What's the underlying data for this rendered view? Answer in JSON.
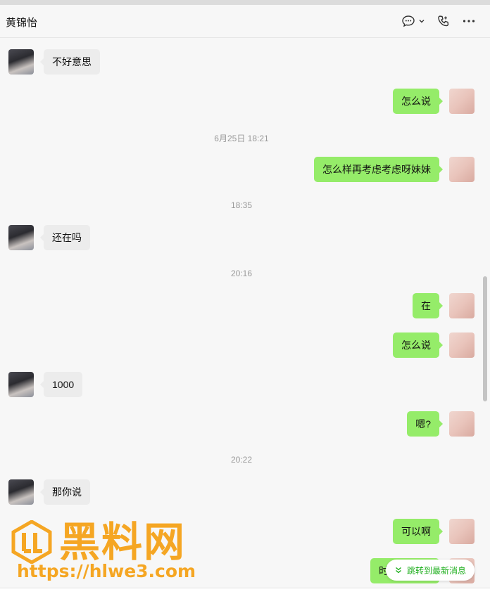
{
  "header": {
    "contact_name": "黄锦怡",
    "icons": [
      "chat-bubble-icon",
      "chevron-down-icon",
      "phone-icon",
      "more-icon"
    ]
  },
  "messages": [
    {
      "from": "other",
      "text": "不好意思"
    },
    {
      "from": "self",
      "text": "怎么说"
    },
    {
      "type": "time",
      "text": "6月25日 18:21"
    },
    {
      "from": "self",
      "text": "怎么样再考虑考虑呀妹妹"
    },
    {
      "type": "time",
      "text": "18:35"
    },
    {
      "from": "other",
      "text": "还在吗"
    },
    {
      "type": "time",
      "text": "20:16"
    },
    {
      "from": "self",
      "text": "在"
    },
    {
      "from": "self",
      "text": "怎么说"
    },
    {
      "from": "other",
      "text": "1000"
    },
    {
      "from": "self",
      "text": "嗯?"
    },
    {
      "type": "time",
      "text": "20:22"
    },
    {
      "from": "other",
      "text": "那你说"
    },
    {
      "from": "self",
      "text": "可以啊"
    },
    {
      "from": "self",
      "text": "时"
    }
  ],
  "jump_button": {
    "label": "跳转到最新消息",
    "icon": "double-chevron-down-icon"
  },
  "watermark": {
    "text": "黑料网",
    "url": "https://hlwe3.com"
  },
  "colors": {
    "self_bubble": "#95ec69",
    "other_bubble": "#ececec",
    "accent": "#1aad19",
    "watermark": "#f5a623"
  }
}
